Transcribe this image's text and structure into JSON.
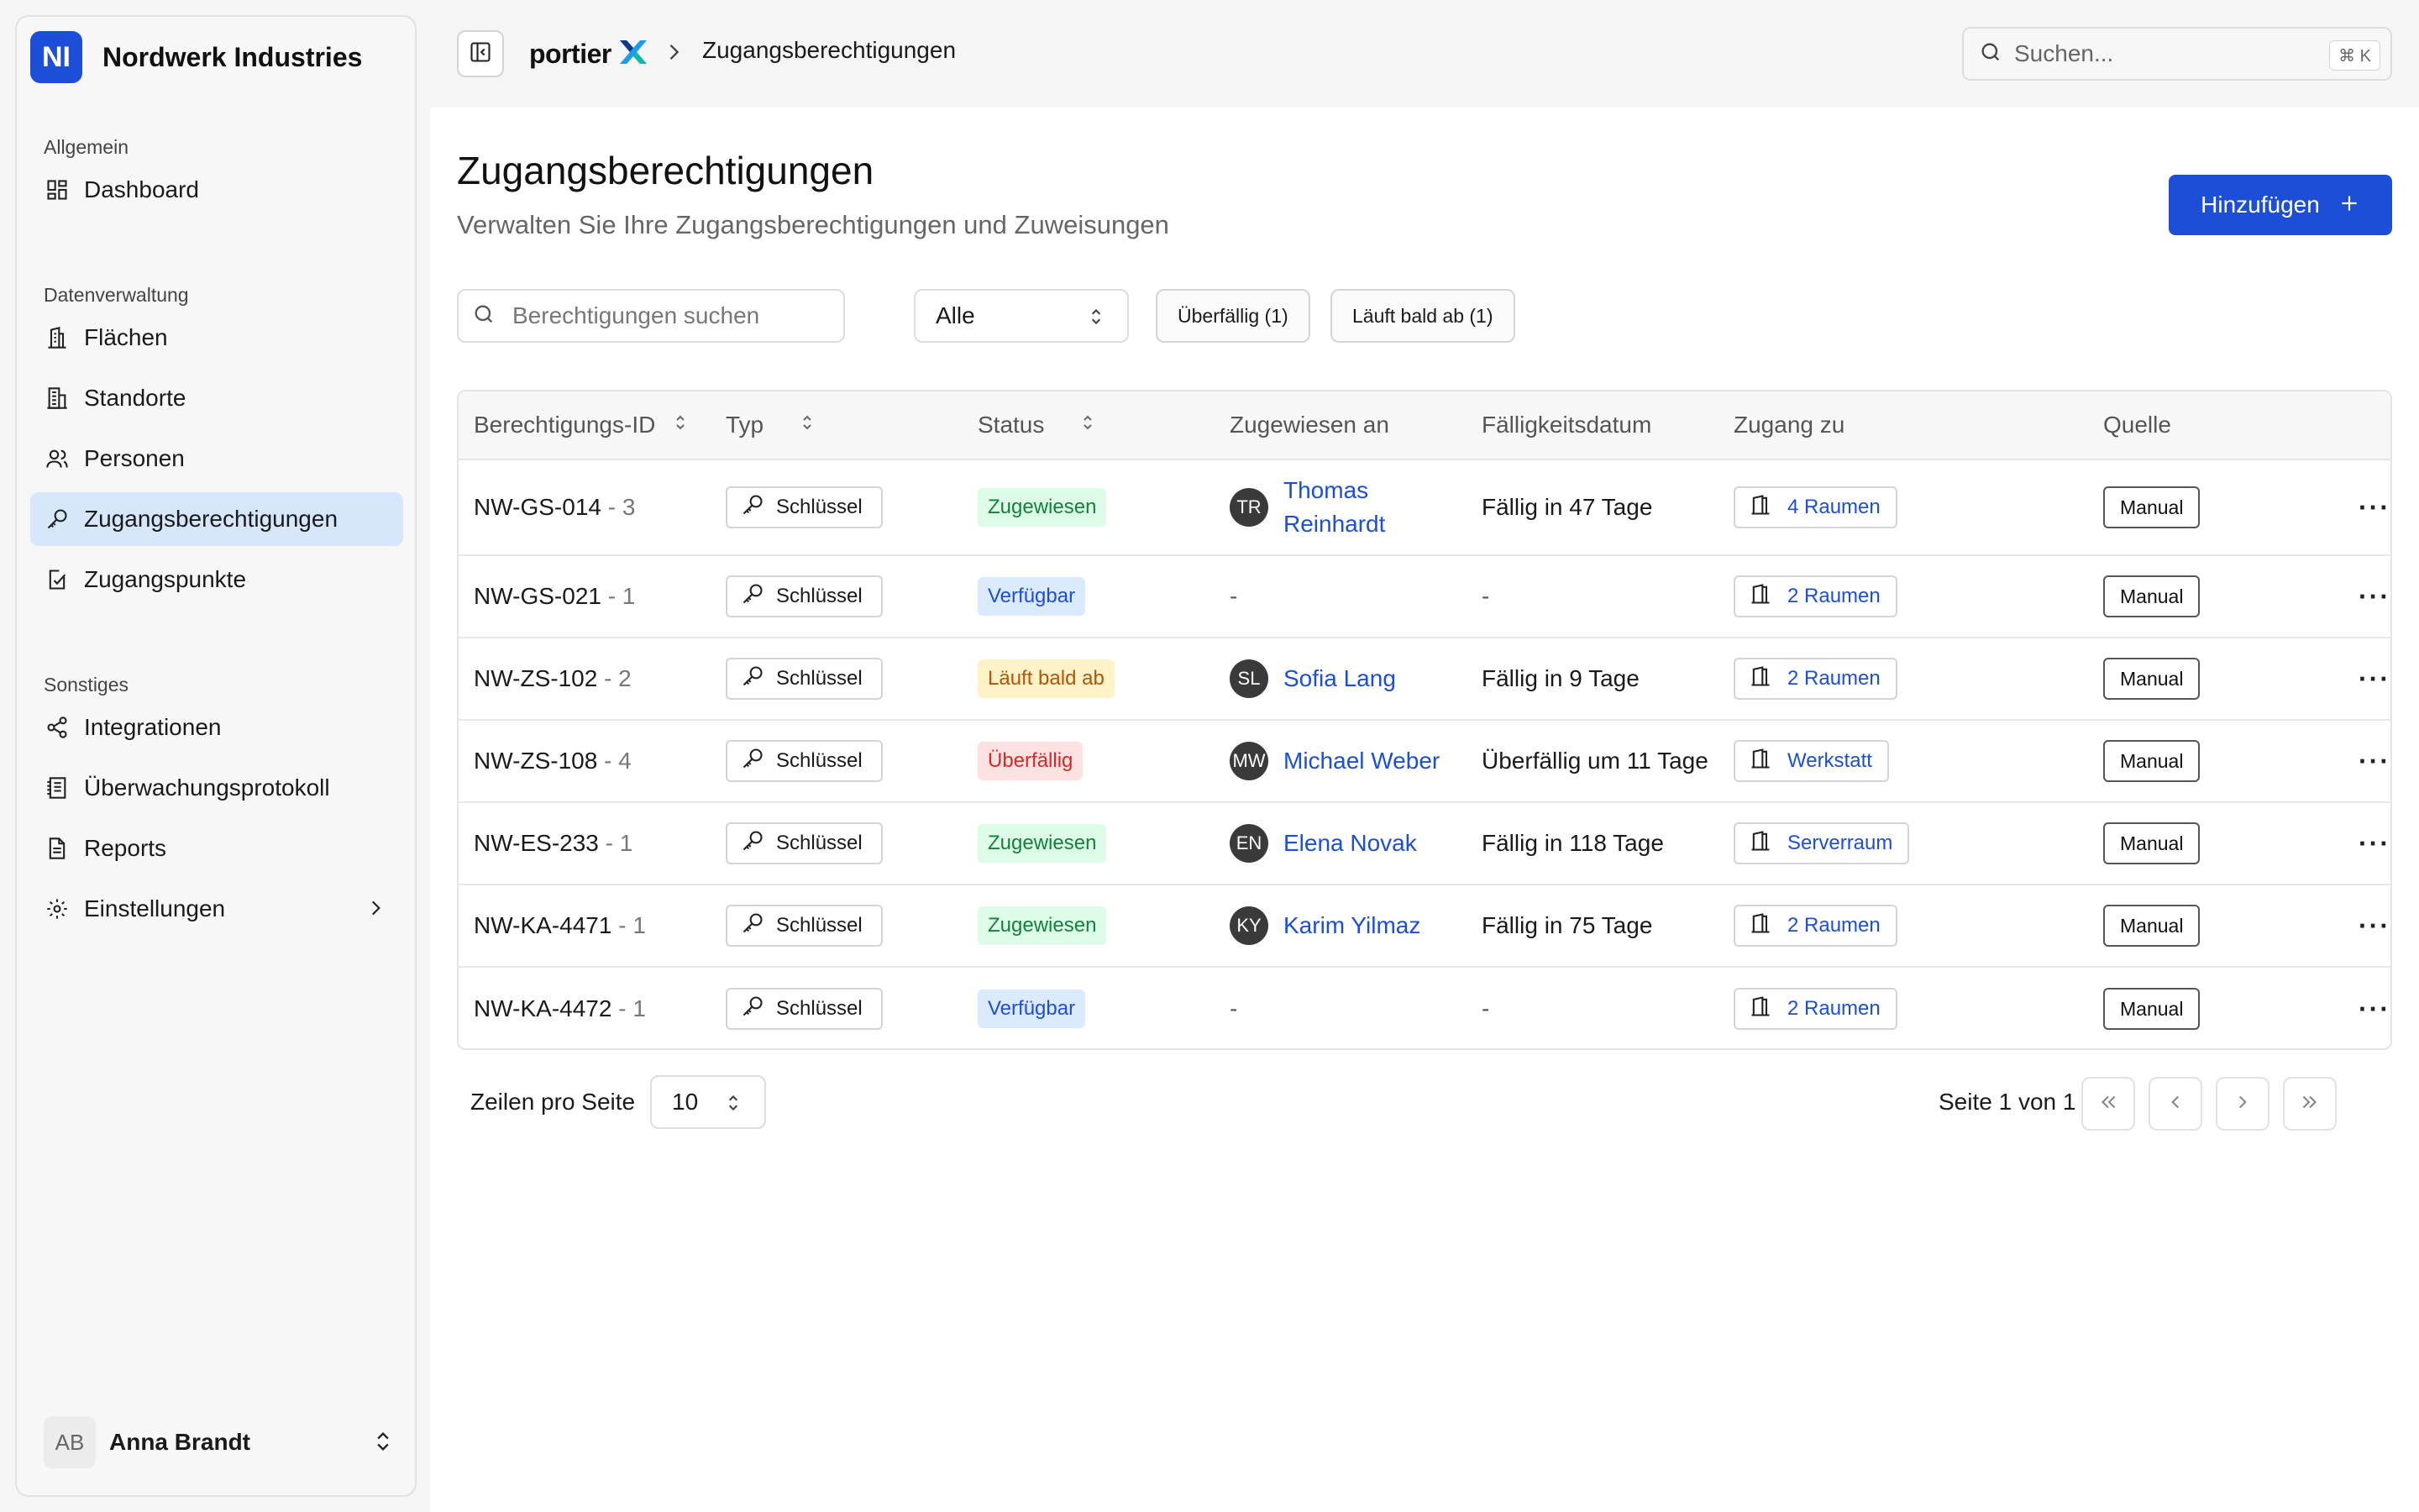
{
  "org": {
    "initials": "NI",
    "name": "Nordwerk Industries"
  },
  "sidebar": {
    "sections": [
      {
        "title": "Allgemein",
        "items": [
          {
            "label": "Dashboard",
            "icon": "dashboard-icon"
          }
        ]
      },
      {
        "title": "Datenverwaltung",
        "items": [
          {
            "label": "Flächen",
            "icon": "building-icon"
          },
          {
            "label": "Standorte",
            "icon": "buildings-icon"
          },
          {
            "label": "Personen",
            "icon": "users-icon"
          },
          {
            "label": "Zugangsberechtigungen",
            "icon": "key-icon",
            "active": true
          },
          {
            "label": "Zugangspunkte",
            "icon": "door-check-icon"
          }
        ]
      },
      {
        "title": "Sonstiges",
        "items": [
          {
            "label": "Integrationen",
            "icon": "share-icon"
          },
          {
            "label": "Überwachungsprotokoll",
            "icon": "log-icon"
          },
          {
            "label": "Reports",
            "icon": "report-icon"
          },
          {
            "label": "Einstellungen",
            "icon": "gear-icon",
            "has_chevron": true
          }
        ]
      }
    ]
  },
  "user": {
    "initials": "AB",
    "name": "Anna Brandt"
  },
  "topbar": {
    "brand": "portier",
    "breadcrumb_current": "Zugangsberechtigungen",
    "search_placeholder": "Suchen...",
    "search_shortcut": "⌘ K"
  },
  "page": {
    "title": "Zugangsberechtigungen",
    "subtitle": "Verwalten Sie Ihre Zugangsberechtigungen und Zuweisungen",
    "add_label": "Hinzufügen"
  },
  "filters": {
    "search_placeholder": "Berechtigungen suchen",
    "select_value": "Alle",
    "chip_overdue": "Überfällig (1)",
    "chip_expiring": "Läuft bald ab (1)"
  },
  "table": {
    "columns": [
      "Berechtigungs-ID",
      "Typ",
      "Status",
      "Zugewiesen an",
      "Fälligkeitsdatum",
      "Zugang zu",
      "Quelle"
    ],
    "rows": [
      {
        "id": "NW-GS-014",
        "suffix": " - 3",
        "type": "Schlüssel",
        "status": "Zugewiesen",
        "status_kind": "assigned",
        "initials": "TR",
        "person": "Thomas Reinhardt",
        "due": "Fällig in 47 Tage",
        "access": "4 Raumen",
        "source": "Manual"
      },
      {
        "id": "NW-GS-021",
        "suffix": " - 1",
        "type": "Schlüssel",
        "status": "Verfügbar",
        "status_kind": "available",
        "initials": "",
        "person": "-",
        "due": "-",
        "access": "2 Raumen",
        "source": "Manual"
      },
      {
        "id": "NW-ZS-102",
        "suffix": " - 2",
        "type": "Schlüssel",
        "status": "Läuft bald ab",
        "status_kind": "expiring",
        "initials": "SL",
        "person": "Sofia Lang",
        "due": "Fällig in 9 Tage",
        "access": "2 Raumen",
        "source": "Manual"
      },
      {
        "id": "NW-ZS-108",
        "suffix": " - 4",
        "type": "Schlüssel",
        "status": "Überfällig",
        "status_kind": "overdue",
        "initials": "MW",
        "person": "Michael Weber",
        "due": "Überfällig um 11 Tage",
        "access": "Werkstatt",
        "source": "Manual"
      },
      {
        "id": "NW-ES-233",
        "suffix": " - 1",
        "type": "Schlüssel",
        "status": "Zugewiesen",
        "status_kind": "assigned",
        "initials": "EN",
        "person": "Elena Novak",
        "due": "Fällig in 118 Tage",
        "access": "Serverraum",
        "source": "Manual"
      },
      {
        "id": "NW-KA-4471",
        "suffix": " - 1",
        "type": "Schlüssel",
        "status": "Zugewiesen",
        "status_kind": "assigned",
        "initials": "KY",
        "person": "Karim Yilmaz",
        "due": "Fällig in 75 Tage",
        "access": "2 Raumen",
        "source": "Manual"
      },
      {
        "id": "NW-KA-4472",
        "suffix": " - 1",
        "type": "Schlüssel",
        "status": "Verfügbar",
        "status_kind": "available",
        "initials": "",
        "person": "-",
        "due": "-",
        "access": "2 Raumen",
        "source": "Manual"
      }
    ]
  },
  "pagination": {
    "rows_label": "Zeilen pro Seite",
    "rows_value": "10",
    "page_info": "Seite 1 von 1"
  },
  "colors": {
    "accent": "#1d4ed8",
    "assigned_bg": "#dcfce7",
    "assigned_fg": "#15803d",
    "available_bg": "#dbeafe",
    "available_fg": "#1d4ed8",
    "expiring_bg": "#fef3c7",
    "expiring_fg": "#b45309",
    "overdue_bg": "#fee2e2",
    "overdue_fg": "#dc2626"
  }
}
